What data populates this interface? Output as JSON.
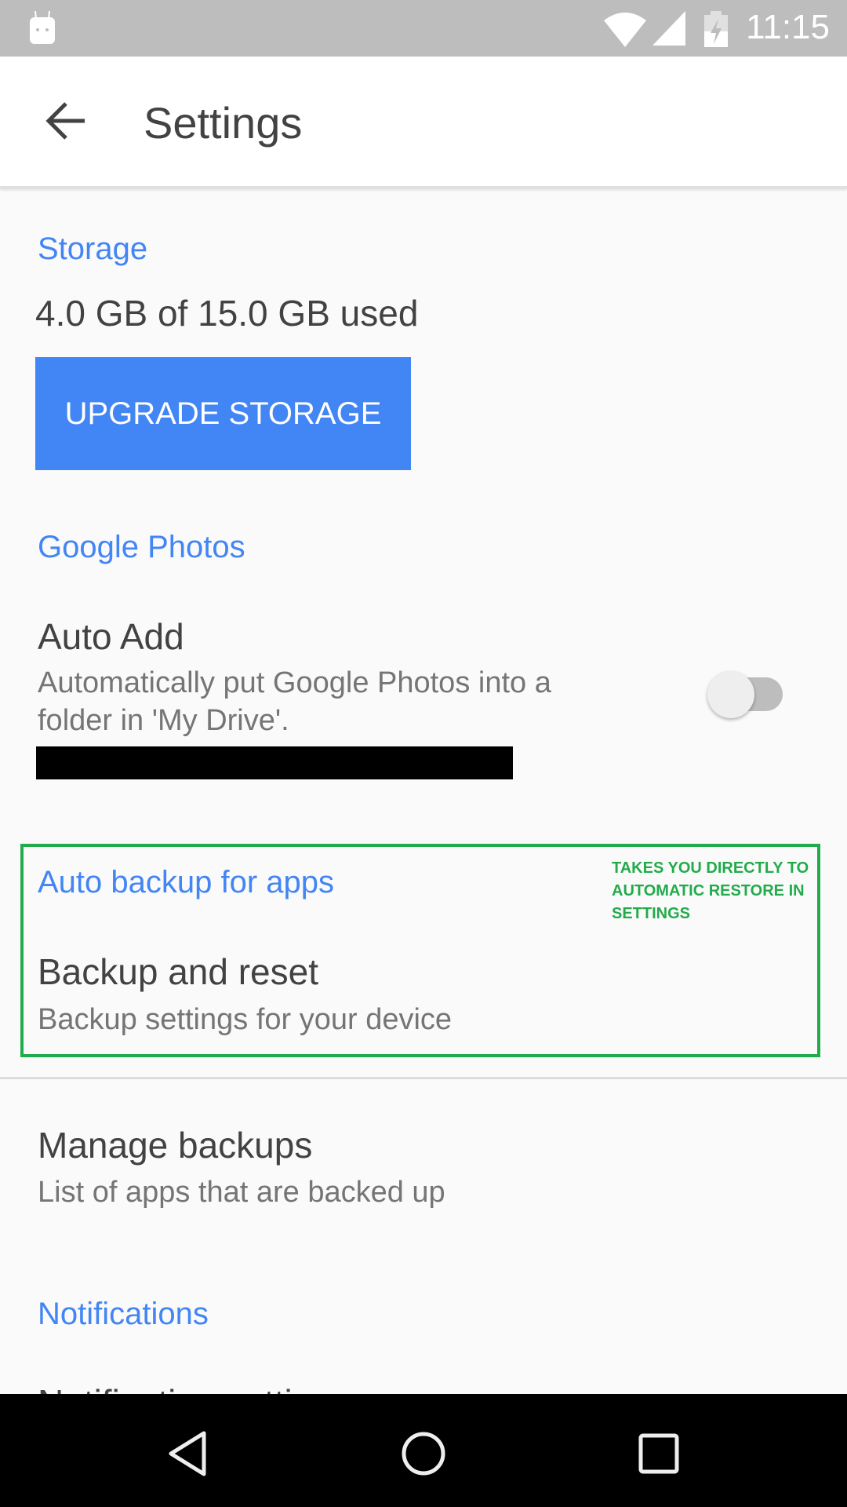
{
  "status_bar": {
    "time": "11:15",
    "icons": [
      "android-debug-icon",
      "wifi-icon",
      "signal-icon",
      "battery-charging-icon"
    ]
  },
  "app_bar": {
    "title": "Settings",
    "back_icon": "arrow-left-icon"
  },
  "storage": {
    "header": "Storage",
    "usage": "4.0 GB of 15.0 GB used",
    "upgrade_label": "UPGRADE STORAGE"
  },
  "google_photos": {
    "header": "Google Photos",
    "auto_add": {
      "title": "Auto Add",
      "description_line1": "Automatically put Google Photos into a",
      "description_line2": "folder in 'My Drive'.",
      "enabled": false
    }
  },
  "auto_backup": {
    "header": "Auto backup for apps",
    "backup_reset": {
      "title": "Backup and reset",
      "description": "Backup settings for your device"
    },
    "annotation": "TAKES YOU DIRECTLY TO AUTOMATIC RESTORE IN SETTINGS"
  },
  "manage_backups": {
    "title": "Manage backups",
    "description": "List of apps that are backed up"
  },
  "notifications": {
    "header": "Notifications",
    "partial_item": "Notification settings"
  },
  "colors": {
    "accent": "#4285f4",
    "annotation": "#22ab4b"
  }
}
